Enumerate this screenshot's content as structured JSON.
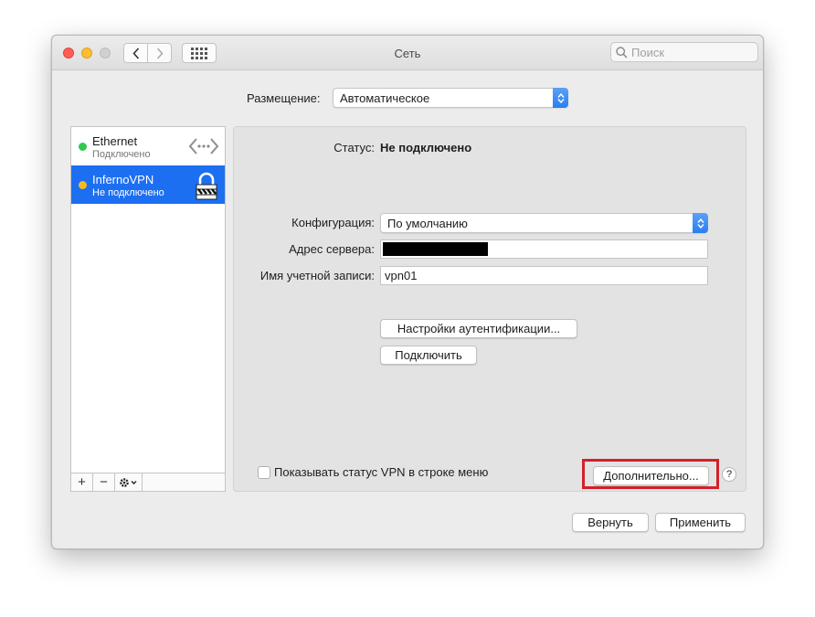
{
  "window": {
    "title": "Сеть"
  },
  "search": {
    "placeholder": "Поиск"
  },
  "location": {
    "label": "Размещение:",
    "value": "Автоматическое"
  },
  "services": [
    {
      "name": "Ethernet",
      "status": "Подключено",
      "status_color": "#2fc94d",
      "icon": "ethernet-arrows-icon",
      "selected": false
    },
    {
      "name": "InfernoVPN",
      "status": "Не подключено",
      "status_color": "#f5b921",
      "icon": "lock-icon",
      "selected": true
    }
  ],
  "sidebar_tools": {
    "add": "+",
    "remove": "−"
  },
  "detail": {
    "status_label": "Статус:",
    "status_value": "Не подключено",
    "config_label": "Конфигурация:",
    "config_value": "По умолчанию",
    "server_label": "Адрес сервера:",
    "server_value": "",
    "account_label": "Имя учетной записи:",
    "account_value": "vpn01",
    "auth_button": "Настройки аутентификации...",
    "connect_button": "Подключить",
    "show_vpn_status": "Показывать статус VPN в строке меню",
    "show_vpn_checked": false,
    "advanced_button": "Дополнительно...",
    "help": "?"
  },
  "footer": {
    "revert": "Вернуть",
    "apply": "Применить"
  },
  "colors": {
    "accent": "#1d6ff2",
    "highlight": "#d4202a"
  }
}
